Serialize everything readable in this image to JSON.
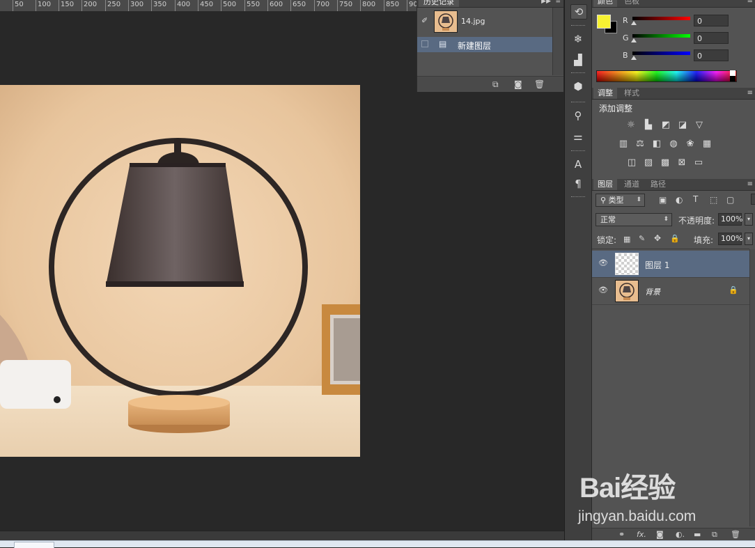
{
  "ruler": {
    "ticks": [
      "50",
      "100",
      "150",
      "200",
      "250",
      "300",
      "350",
      "400",
      "450",
      "500",
      "550",
      "600",
      "650",
      "700",
      "750",
      "800",
      "850",
      "90"
    ]
  },
  "history": {
    "tabs": [
      "历史记录"
    ],
    "snapshot_name": "14.jpg",
    "steps": [
      {
        "label": "新建图层",
        "selected": true
      }
    ],
    "footer_icons": [
      "new-document-icon",
      "camera-icon",
      "trash-icon"
    ]
  },
  "color_panel": {
    "tabs": [
      "颜色",
      "色板"
    ],
    "foreground": "#f7f232",
    "background": "#000000",
    "channels": [
      {
        "label": "R",
        "value": "0",
        "color": "#d11b1b"
      },
      {
        "label": "G",
        "value": "0",
        "color": "#18b11b"
      },
      {
        "label": "B",
        "value": "0",
        "color": "#1a20c9"
      }
    ]
  },
  "adjustments": {
    "tabs": [
      "调整",
      "样式"
    ],
    "heading": "添加调整",
    "row1": [
      "brightness-icon",
      "levels-icon",
      "curves-icon",
      "exposure-icon",
      "vibrance-icon"
    ],
    "row2": [
      "hue-saturation-icon",
      "color-balance-icon",
      "black-white-icon",
      "photo-filter-icon",
      "channel-mixer-icon",
      "color-lookup-icon"
    ],
    "row3": [
      "invert-icon",
      "posterize-icon",
      "threshold-icon",
      "selective-color-icon",
      "gradient-map-icon"
    ]
  },
  "layers": {
    "tabs": [
      "图层",
      "通道",
      "路径"
    ],
    "filter_kind": "类型",
    "blend_mode": "正常",
    "opacity_label": "不透明度:",
    "opacity_value": "100%",
    "lock_label": "锁定:",
    "fill_label": "填充:",
    "fill_value": "100%",
    "items": [
      {
        "name": "图层 1",
        "selected": true,
        "visible": true
      },
      {
        "name": "背景",
        "selected": false,
        "visible": true,
        "locked": true
      }
    ]
  },
  "watermark": {
    "logo_text": "Bai经验",
    "site_text": "jingyan.baidu.com"
  },
  "colors": {
    "panel": "#535353",
    "selection": "#596a82",
    "canvas": "#282828"
  }
}
